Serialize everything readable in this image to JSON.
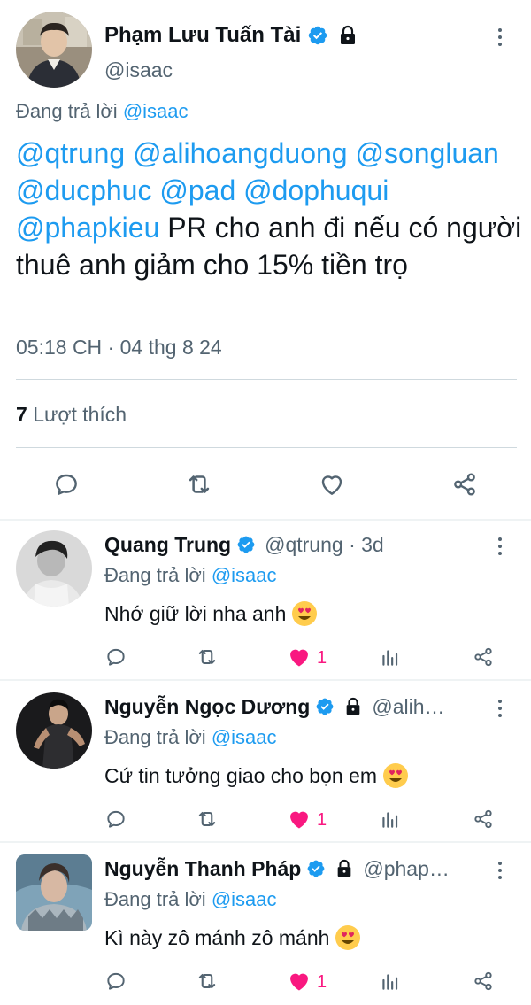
{
  "main_tweet": {
    "author_name": "Phạm Lưu Tuấn Tài",
    "handle": "@isaac",
    "replying_prefix": "Đang trả lời",
    "replying_to": "@isaac",
    "text_mentions": [
      "@qtrung",
      "@alihoangduong",
      "@songluan",
      "@ducphuc",
      "@pad",
      "@dophuqui",
      "@phapkieu"
    ],
    "text_body": "PR cho anh đi nếu có người thuê anh giảm cho 15% tiền trọ",
    "timestamp": "05:18 CH · 04 thg 8 24",
    "like_count": "7",
    "like_label": "Lượt thích",
    "actions": [
      "reply-icon",
      "retweet-icon",
      "heart-icon",
      "share-icon"
    ]
  },
  "replies": [
    {
      "author_name": "Quang Trung",
      "handle_time": "@qtrung · 3d",
      "verified": true,
      "protected": false,
      "replying_prefix": "Đang trả lời",
      "replying_to": "@isaac",
      "text": "Nhớ giữ lời nha anh",
      "emoji": "heart-eyes-emoji",
      "like_count": "1"
    },
    {
      "author_name": "Nguyễn Ngọc Dương",
      "handle_time": "@alih…",
      "verified": true,
      "protected": true,
      "replying_prefix": "Đang trả lời",
      "replying_to": "@isaac",
      "text": "Cứ tin tưởng giao cho bọn em",
      "emoji": "heart-eyes-emoji",
      "like_count": "1"
    },
    {
      "author_name": "Nguyễn Thanh Pháp",
      "handle_time": "@phap…",
      "verified": true,
      "protected": true,
      "replying_prefix": "Đang trả lời",
      "replying_to": "@isaac",
      "text": "Kì này zô mánh zô mánh",
      "emoji": "heart-eyes-emoji",
      "like_count": "1"
    }
  ],
  "colors": {
    "accent": "#1d9bf0",
    "liked": "#f91880",
    "secondary_text": "#536471",
    "primary_text": "#0f1419"
  }
}
